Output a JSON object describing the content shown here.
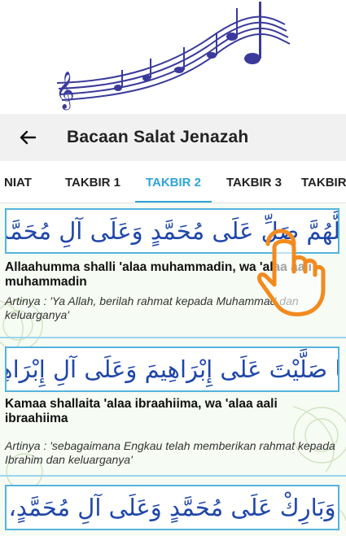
{
  "app_bar": {
    "title": "Bacaan Salat Jenazah",
    "back_icon": "arrow-left-icon"
  },
  "tabs": [
    {
      "label": "NIAT",
      "active": false
    },
    {
      "label": "TAKBIR 1",
      "active": false
    },
    {
      "label": "TAKBIR 2",
      "active": true
    },
    {
      "label": "TAKBIR 3",
      "active": false
    },
    {
      "label": "TAKBIR",
      "active": false
    }
  ],
  "verses": [
    {
      "arabic_main": "اللَّهُمَّ صَلِّ عَلَى مُحَمَّدٍ وَعَلَى آلِ مُحَمَّدٍ،",
      "latin": "Allaahumma shalli 'alaa muhammadin, wa 'alaa aali muhammadin",
      "meaning": "Artinya : 'Ya Allah, berilah rahmat kepada Muhammad dan keluarganya'"
    },
    {
      "arabic_main": "كَمَا صَلَّيْتَ عَلَى إِبْرَاهِيمَ وَعَلَى آلِ إِبْرَاهِيمَ",
      "latin": "Kamaa shallaita 'alaa ibraahiima, wa 'alaa aali ibraahiima",
      "meaning": "Artinya : 'sebagaimana Engkau telah memberikan rahmat kepada Ibrahim dan keluarganya'"
    },
    {
      "arabic_main": "وَبَارِكْ عَلَى مُحَمَّدٍ وَعَلَى آلِ مُحَمَّدٍ،"
    }
  ],
  "colors": {
    "accent": "#2fa4d8",
    "arabic_text": "#1f47a8",
    "arabic_highlight": "#5fa8e6",
    "tap_hand": "#f28a1e",
    "banner_music": "#3a3a9c"
  },
  "icons": {
    "banner": "music-staff-icon",
    "tap": "tap-hand-icon"
  }
}
